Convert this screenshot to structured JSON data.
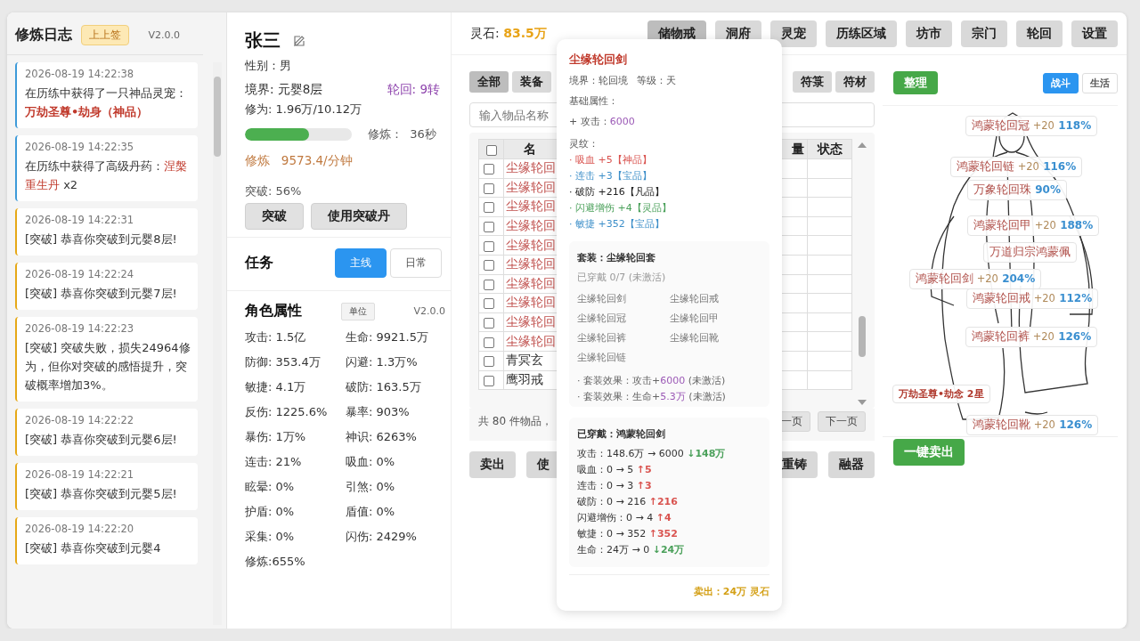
{
  "log_panel": {
    "title": "修炼日志",
    "badge": "上上签",
    "version": "V2.0.0",
    "entries": [
      {
        "time": "2026-08-19 14:22:38",
        "text": "在历练中获得了一只神品灵宠：",
        "highlight": "**万劫圣尊•劫身（神品）**",
        "color": "#3d9ad9"
      },
      {
        "time": "2026-08-19 14:22:35",
        "text": "在历练中获得了高级丹药：",
        "highlight": "涅槃重生丹",
        "suffix": " x2",
        "color": "#3d9ad9"
      },
      {
        "time": "2026-08-19 14:22:31",
        "text": "[突破] 恭喜你突破到元婴8层!",
        "color": "#e6a817"
      },
      {
        "time": "2026-08-19 14:22:24",
        "text": "[突破] 恭喜你突破到元婴7层!",
        "color": "#e6a817"
      },
      {
        "time": "2026-08-19 14:22:23",
        "text": "[突破] 突破失败，损失24964修为，但你对突破的感悟提升，突破概率增加3%。",
        "color": "#e6a817"
      },
      {
        "time": "2026-08-19 14:22:22",
        "text": "[突破] 恭喜你突破到元婴6层!",
        "color": "#e6a817"
      },
      {
        "time": "2026-08-19 14:22:21",
        "text": "[突破] 恭喜你突破到元婴5层!",
        "color": "#e6a817"
      },
      {
        "time": "2026-08-19 14:22:20",
        "text": "[突破] 恭喜你突破到元婴4",
        "color": "#e6a817"
      }
    ]
  },
  "character": {
    "name": "张三",
    "gender": "性别：男",
    "realm": "境界: 元婴8层",
    "rebirth": "轮回: 9转",
    "cultivation": "修为: 1.96万/10.12万",
    "progress": {
      "level": 0.6
    },
    "timer": "修炼：  36秒",
    "rate": "修炼   9573.4/分钟",
    "breakthrough": "突破: 56%",
    "buttons": [
      "突破",
      "使用突破丹"
    ]
  },
  "tasks": {
    "title": "任务",
    "tabs": [
      {
        "label": "主线",
        "selected": true
      },
      {
        "label": "日常",
        "selected": false
      }
    ]
  },
  "attributes": {
    "title": "角色属性",
    "unit_button": "单位",
    "version": "V2.0.0",
    "stats": [
      "攻击: 1.5亿",
      "生命: 9921.5万",
      "防御: 353.4万",
      "闪避: 1.3万%",
      "敏捷: 4.1万",
      "破防: 163.5万",
      "反伤: 1225.6%",
      "暴率: 903%",
      "暴伤: 1万%",
      "神识: 6263%",
      "连击: 21%",
      "吸血: 0%",
      "眩晕: 0%",
      "引煞: 0%",
      "护盾: 0%",
      "盾值: 0%",
      "采集: 0%",
      "闪伤: 2429%",
      "修炼:655%"
    ]
  },
  "top_bar": {
    "currency_label": "灵石:",
    "currency_value": "83.5万",
    "nav": [
      {
        "label": "储物戒",
        "selected": true
      },
      {
        "label": "洞府",
        "selected": false
      },
      {
        "label": "灵宠",
        "selected": false
      },
      {
        "label": "历练区域",
        "selected": false
      },
      {
        "label": "坊市",
        "selected": false
      },
      {
        "label": "宗门",
        "selected": false
      },
      {
        "label": "轮回",
        "selected": false
      },
      {
        "label": "设置",
        "selected": false
      }
    ]
  },
  "inventory": {
    "tabs_left": [
      {
        "label": "全部",
        "selected": true
      },
      {
        "label": "装备",
        "selected": false
      }
    ],
    "tabs_right": [
      {
        "label": "符箓",
        "selected": false
      },
      {
        "label": "符材",
        "selected": false
      }
    ],
    "search": {
      "placeholder": "输入物品名称"
    },
    "select_all": {
      "checked": false
    },
    "columns": [
      "名",
      "量",
      "状态"
    ],
    "rows": [
      {
        "name": "尘缘轮回",
        "color": "#c0504d",
        "checked": false
      },
      {
        "name": "尘缘轮回",
        "color": "#c0504d",
        "checked": false
      },
      {
        "name": "尘缘轮回",
        "color": "#c0504d",
        "checked": false
      },
      {
        "name": "尘缘轮回",
        "color": "#c0504d",
        "checked": false
      },
      {
        "name": "尘缘轮回",
        "color": "#c0504d",
        "checked": false
      },
      {
        "name": "尘缘轮回",
        "color": "#c0504d",
        "checked": false
      },
      {
        "name": "尘缘轮回",
        "color": "#c0504d",
        "checked": false
      },
      {
        "name": "尘缘轮回",
        "color": "#c0504d",
        "checked": false
      },
      {
        "name": "尘缘轮回",
        "color": "#c0504d",
        "checked": false
      },
      {
        "name": "尘缘轮回",
        "color": "#c0504d",
        "checked": false
      },
      {
        "name": "青冥玄",
        "color": "#333333",
        "checked": false
      },
      {
        "name": "鹰羽戒",
        "color": "#333333",
        "checked": false
      }
    ],
    "summary": "共 80 件物品，",
    "pagination": [
      "一页",
      "下一页"
    ],
    "actions_left": [
      "卖出",
      "使"
    ],
    "actions_right": [
      "重铸",
      "融器"
    ]
  },
  "item_tooltip": {
    "title": "尘缘轮回剑",
    "meta": "境界：轮回境   等级：天",
    "base_title": "基础属性：",
    "base_stats": [
      {
        "label": "+ 攻击：",
        "value": "6000"
      }
    ],
    "affix_title": "灵纹：",
    "affixes": [
      {
        "text": "· 吸血 +5【神品】",
        "color": "#d9534f"
      },
      {
        "text": "· 连击 +3【宝品】",
        "color": "#3d8fc9"
      },
      {
        "text": "· 破防 +216【凡品】",
        "color": "#222222"
      },
      {
        "text": "· 闪避增伤 +4【灵品】",
        "color": "#4aa05a"
      },
      {
        "text": "· 敏捷 +352【宝品】",
        "color": "#3d8fc9"
      }
    ],
    "set": {
      "title": "套装：尘缘轮回套",
      "progress": "已穿戴 0/7 (未激活)",
      "active": false,
      "pieces": [
        "尘缘轮回剑",
        "尘缘轮回戒",
        "尘缘轮回冠",
        "尘缘轮回甲",
        "尘缘轮回裤",
        "尘缘轮回靴",
        "尘缘轮回链"
      ],
      "effects": [
        {
          "prefix": "· 套装效果：攻击+",
          "value": "6000",
          "suffix": " (未激活)"
        },
        {
          "prefix": "· 套装效果：生命+",
          "value": "5.3万",
          "suffix": " (未激活)"
        }
      ]
    },
    "compare": {
      "title": "已穿戴：鸿蒙轮回剑",
      "lines": [
        {
          "text": "攻击：148.6万 → 6000",
          "delta": "↓148万",
          "color": "#4aa05a"
        },
        {
          "text": "吸血：0 → 5",
          "delta": "↑5",
          "color": "#d9534f"
        },
        {
          "text": "连击：0 → 3",
          "delta": "↑3",
          "color": "#d9534f"
        },
        {
          "text": "破防：0 → 216",
          "delta": "↑216",
          "color": "#d9534f"
        },
        {
          "text": "闪避增伤：0 → 4",
          "delta": "↑4",
          "color": "#d9534f"
        },
        {
          "text": "敏捷：0 → 352",
          "delta": "↑352",
          "color": "#d9534f"
        },
        {
          "text": "生命：24万 → 0",
          "delta": "↓24万",
          "color": "#4aa05a"
        }
      ]
    },
    "sell": "卖出：24万 灵石"
  },
  "equipment": {
    "sort_button": "整理",
    "tabs": [
      {
        "label": "战斗",
        "selected": true
      },
      {
        "label": "生活",
        "selected": false
      }
    ],
    "slots": [
      {
        "kind": "equip",
        "name": "鸿蒙轮回冠",
        "enhance": "+20",
        "bonus": "118%"
      },
      {
        "kind": "equip",
        "name": "鸿蒙轮回链",
        "enhance": "+20",
        "bonus": "116%"
      },
      {
        "kind": "equip",
        "name": "万象轮回珠",
        "bonus": "90%"
      },
      {
        "kind": "equip",
        "name": "鸿蒙轮回甲",
        "enhance": "+20",
        "bonus": "188%"
      },
      {
        "kind": "equip",
        "name": "万道归宗鸿蒙佩"
      },
      {
        "kind": "equip",
        "name": "鸿蒙轮回剑",
        "enhance": "+20",
        "bonus": "204%"
      },
      {
        "kind": "equip",
        "name": "鸿蒙轮回戒",
        "enhance": "+20",
        "bonus": "112%"
      },
      {
        "kind": "equip",
        "name": "鸿蒙轮回裤",
        "enhance": "+20",
        "bonus": "126%"
      },
      {
        "kind": "pet",
        "name": "万劫圣尊•劫念 2星"
      },
      {
        "kind": "equip",
        "name": "鸿蒙轮回靴",
        "enhance": "+20",
        "bonus": "126%"
      }
    ],
    "sell_all_button": "一键卖出"
  }
}
